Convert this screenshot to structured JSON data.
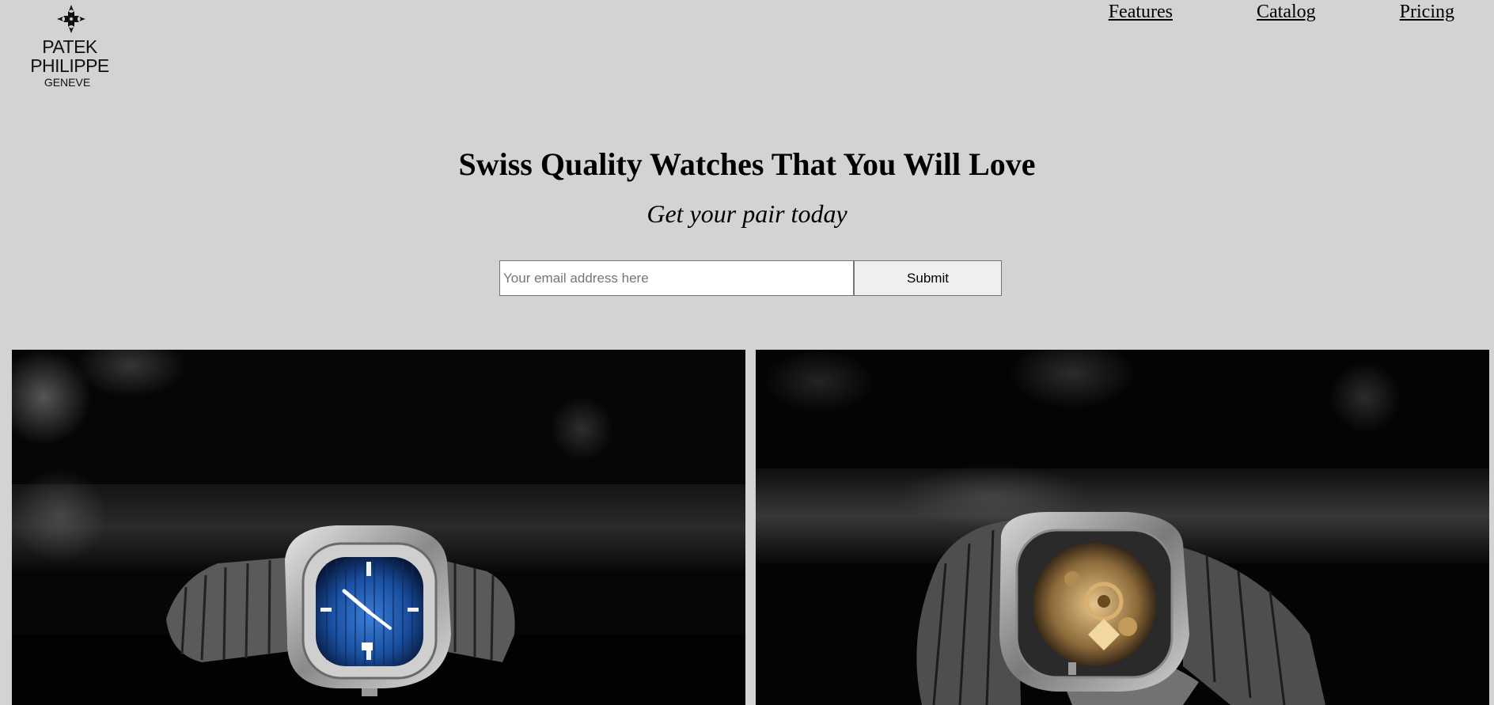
{
  "logo": {
    "name": "PATEK PHILIPPE",
    "city": "GENEVE"
  },
  "nav": {
    "items": [
      "Features",
      "Catalog",
      "Pricing"
    ]
  },
  "hero": {
    "title": "Swiss Quality Watches That You Will Love",
    "subtitle": "Get your pair today"
  },
  "signup": {
    "email_placeholder": "Your email address here",
    "email_value": "",
    "submit_label": "Submit"
  },
  "colors": {
    "page_background": "#d3d3d3",
    "dial_blue": "#1a4fa0"
  },
  "photos": [
    {
      "name": "watch-front-photo"
    },
    {
      "name": "watch-caseback-photo"
    }
  ]
}
